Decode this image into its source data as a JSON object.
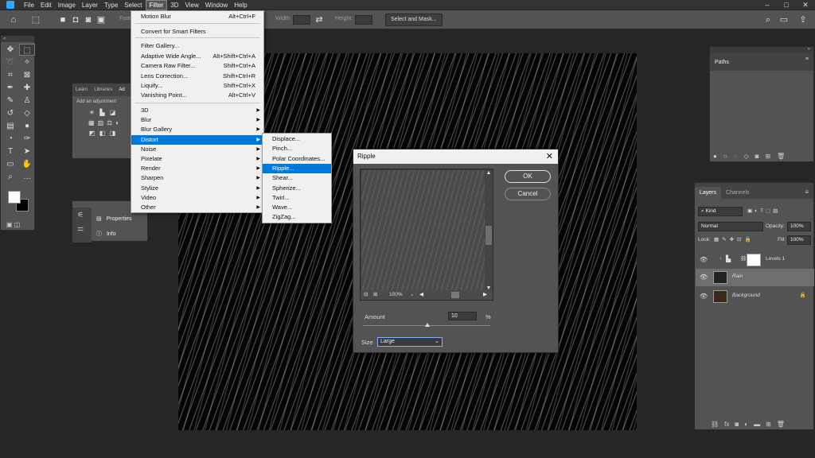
{
  "menubar": {
    "items": [
      "File",
      "Edit",
      "Image",
      "Layer",
      "Type",
      "Select",
      "Filter",
      "3D",
      "View",
      "Window",
      "Help"
    ],
    "active": "Filter"
  },
  "optbar": {
    "feather_label": "Feath",
    "width_label": "Width:",
    "height_label": "Height:",
    "select_mask_label": "Select and Mask..."
  },
  "filter_menu": {
    "items": [
      {
        "label": "Motion Blur",
        "shortcut": "Alt+Ctrl+F"
      },
      {
        "label": "Convert for Smart Filters",
        "shortcut": ""
      },
      {
        "label": "Filter Gallery...",
        "shortcut": ""
      },
      {
        "label": "Adaptive Wide Angle...",
        "shortcut": "Alt+Shift+Ctrl+A"
      },
      {
        "label": "Camera Raw Filter...",
        "shortcut": "Shift+Ctrl+A"
      },
      {
        "label": "Lens Correction...",
        "shortcut": "Shift+Ctrl+R"
      },
      {
        "label": "Liquify...",
        "shortcut": "Shift+Ctrl+X"
      },
      {
        "label": "Vanishing Point...",
        "shortcut": "Alt+Ctrl+V"
      }
    ],
    "submenus": [
      "3D",
      "Blur",
      "Blur Gallery",
      "Distort",
      "Noise",
      "Pixelate",
      "Render",
      "Sharpen",
      "Stylize",
      "Video",
      "Other"
    ],
    "highlighted": "Distort"
  },
  "distort_menu": {
    "items": [
      "Displace...",
      "Pinch...",
      "Polar Coordinates...",
      "Ripple...",
      "Shear...",
      "Spherize...",
      "Twirl...",
      "Wave...",
      "ZigZag..."
    ],
    "highlighted": "Ripple..."
  },
  "adjustments": {
    "tabs": [
      "Learn",
      "Libraries",
      "Ad"
    ],
    "subtitle": "Add an adjustment"
  },
  "properties": {
    "properties_label": "Properties",
    "info_label": "Info"
  },
  "ripple_dialog": {
    "title": "Ripple",
    "ok_label": "OK",
    "cancel_label": "Cancel",
    "zoom": "100%",
    "amount_label": "Amount",
    "amount_value": "10",
    "amount_unit": "%",
    "size_label": "Size",
    "size_value": "Large"
  },
  "paths_panel": {
    "tab": "Paths"
  },
  "layers_panel": {
    "tabs": [
      "Layers",
      "Channels"
    ],
    "kind_label": "Kind",
    "blend_mode": "Normal",
    "opacity_label": "Opacity:",
    "opacity_value": "100%",
    "lock_label": "Lock:",
    "fill_label": "Fill:",
    "fill_value": "100%",
    "layers": [
      {
        "name": "Levels 1"
      },
      {
        "name": "Rain"
      },
      {
        "name": "Background"
      }
    ]
  }
}
